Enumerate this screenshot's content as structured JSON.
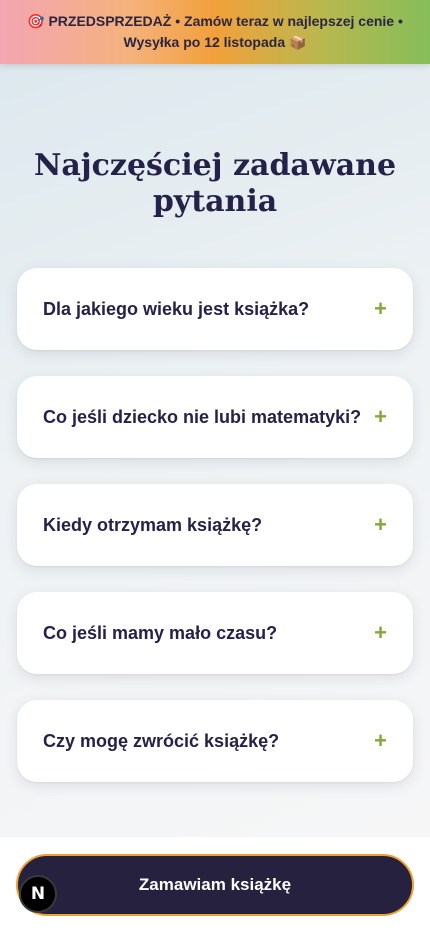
{
  "promo": {
    "icon": "🎯",
    "line1": "PRZEDSPRZEDAŻ • Zamów teraz w najlepszej cenie •",
    "line2": "Wysyłka po 12 listopada",
    "line2_icon": "📦"
  },
  "faq": {
    "title": "Najczęściej zadawane pytania",
    "items": [
      {
        "question": "Dla jakiego wieku jest książka?",
        "icon": "+"
      },
      {
        "question": "Co jeśli dziecko nie lubi matematyki?",
        "icon": "+"
      },
      {
        "question": "Kiedy otrzymam książkę?",
        "icon": "+"
      },
      {
        "question": "Co jeśli mamy mało czasu?",
        "icon": "+"
      },
      {
        "question": "Czy mogę zwrócić książkę?",
        "icon": "+"
      }
    ]
  },
  "cta": {
    "label": "Zamawiam książkę"
  },
  "dev_badge": {
    "letter": "N"
  },
  "colors": {
    "accent_green": "#86a83a",
    "navy": "#25224a",
    "cta_border": "#f0a030"
  }
}
